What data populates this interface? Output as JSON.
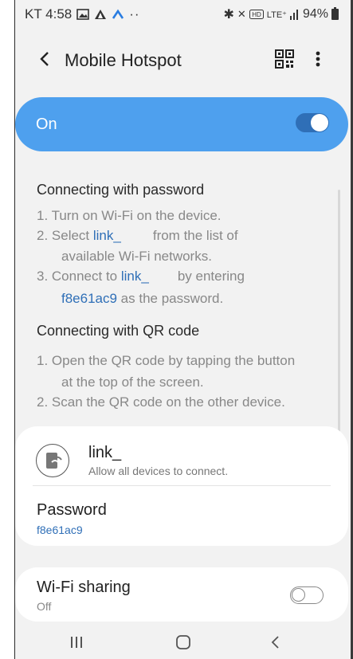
{
  "status_bar": {
    "carrier_time": "KT 4:58",
    "left_icons": [
      "image-icon",
      "alert-icon",
      "nav-up-icon",
      "more-dots-icon"
    ],
    "battery": "94%",
    "right_icons": [
      "bluetooth-icon",
      "mute-icon",
      "hd-icon",
      "lte-icon",
      "signal-icon",
      "battery-icon"
    ]
  },
  "app_bar": {
    "title": "Mobile Hotspot"
  },
  "hotspot": {
    "state_label": "On",
    "enabled": true
  },
  "password_section": {
    "heading": "Connecting with password",
    "step1": "1. Turn on Wi-Fi on the device.",
    "step2_prefix": "2. Select ",
    "step2_link": "link_",
    "step2_suffix": "from the list of",
    "step2_line2": "available Wi-Fi networks.",
    "step3_prefix": "3. Connect to ",
    "step3_link": "link_",
    "step3_suffix": "by entering",
    "step3_password": "f8e61ac9",
    "step3_end": " as the password."
  },
  "qr_section": {
    "heading": "Connecting with QR code",
    "step1_line1": "1. Open the QR code by tapping the button",
    "step1_line2": "at the top of the screen.",
    "step2": "2. Scan the QR code on the other device."
  },
  "network": {
    "name": "link_",
    "subtitle": "Allow all devices to connect.",
    "password_label": "Password",
    "password_value": "f8e61ac9"
  },
  "wifi_sharing": {
    "label": "Wi-Fi sharing",
    "state": "Off",
    "enabled": false
  },
  "colors": {
    "accent": "#4ea0ee",
    "link": "#2f6fb7"
  }
}
